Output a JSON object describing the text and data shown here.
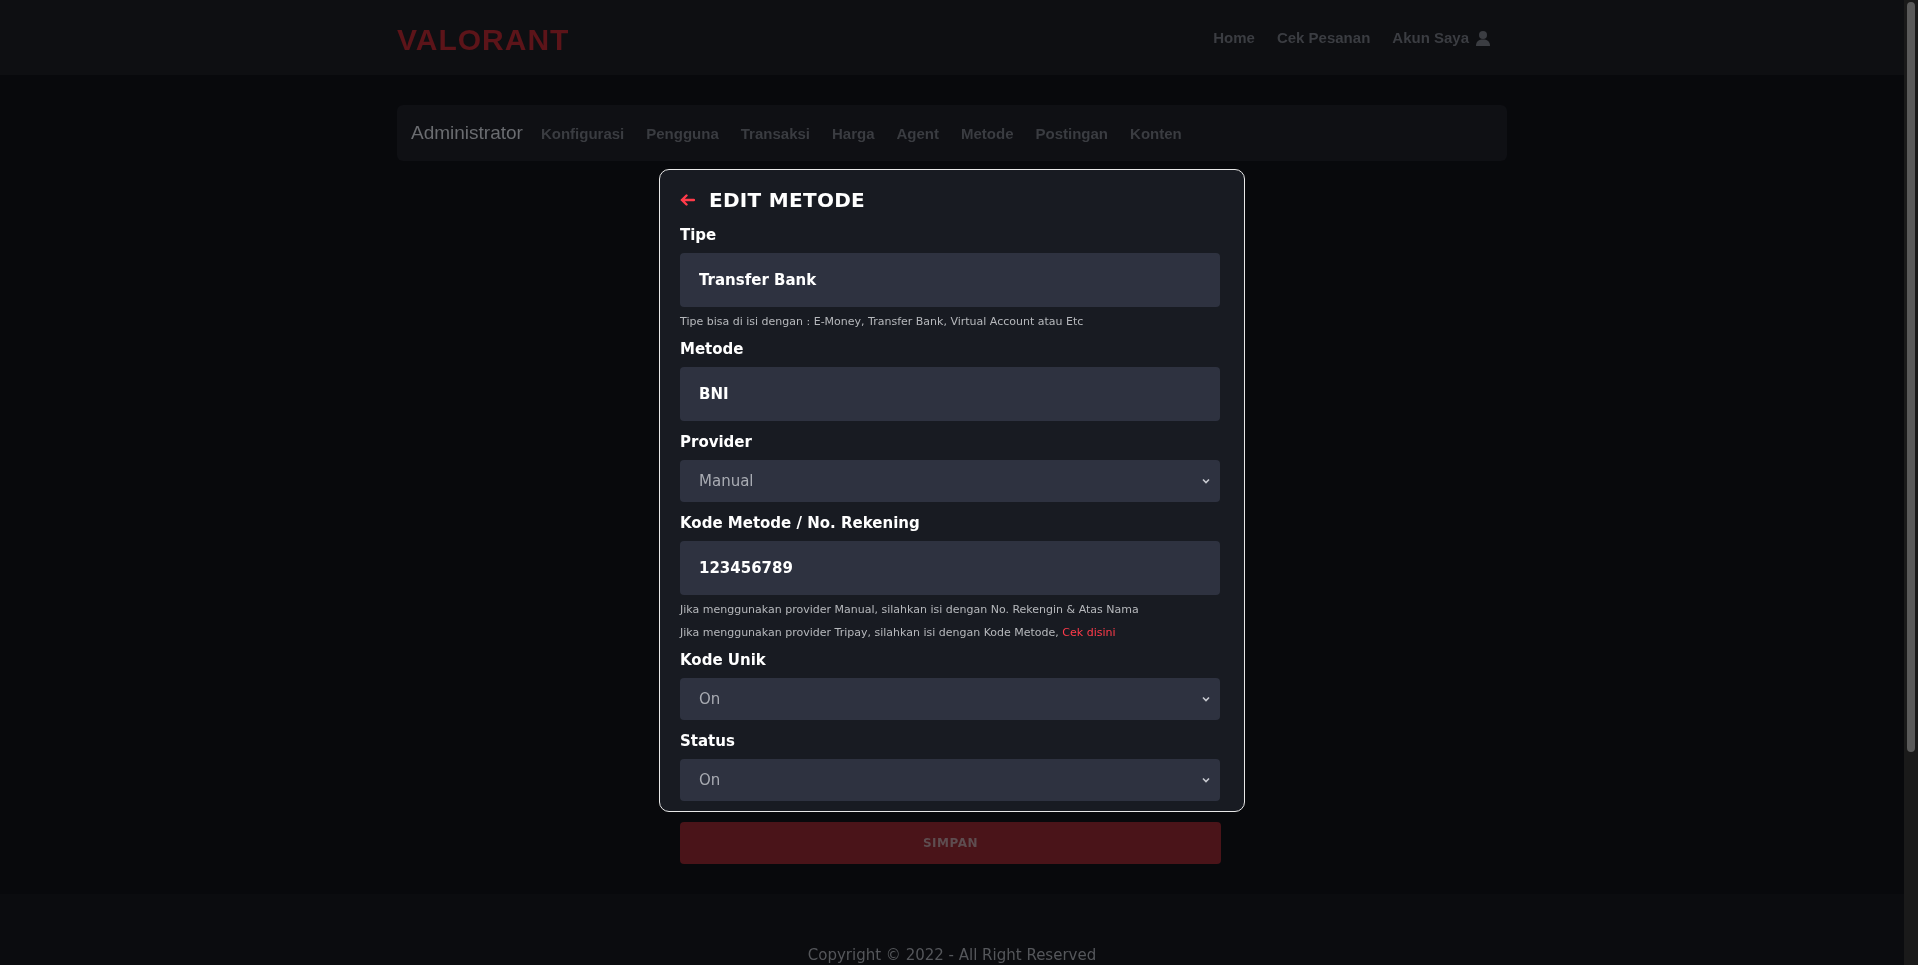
{
  "header": {
    "logo": "VALORANT",
    "nav": [
      {
        "label": "Home",
        "kind": "link"
      },
      {
        "label": "Cek Pesanan",
        "kind": "link"
      },
      {
        "label": "Akun Saya",
        "kind": "account"
      }
    ]
  },
  "admin_bar": {
    "title": "Administrator",
    "items": [
      "Konfigurasi",
      "Pengguna",
      "Transaksi",
      "Harga",
      "Agent",
      "Metode",
      "Postingan",
      "Konten"
    ]
  },
  "form": {
    "title": "EDIT METODE",
    "fields": [
      {
        "kind": "input",
        "label": "Tipe",
        "value": "Transfer Bank",
        "hints": [
          {
            "text": "Tipe bisa di isi dengan : E-Money, Transfer Bank, Virtual Account atau Etc"
          }
        ]
      },
      {
        "kind": "input",
        "label": "Metode",
        "value": "BNI"
      },
      {
        "kind": "select",
        "label": "Provider",
        "value": "Manual"
      },
      {
        "kind": "input",
        "label": "Kode Metode / No. Rekening",
        "value": "123456789",
        "hints": [
          {
            "text": "Jika menggunakan provider Manual, silahkan isi dengan No. Rekengin & Atas Nama"
          },
          {
            "text": "Jika menggunakan provider Tripay, silahkan isi dengan Kode Metode, ",
            "link": "Cek disini"
          }
        ]
      },
      {
        "kind": "select",
        "label": "Kode Unik",
        "value": "On"
      },
      {
        "kind": "select",
        "label": "Status",
        "value": "On"
      }
    ],
    "submit": "SIMPAN"
  },
  "footer": {
    "copyright": "Copyright © 2022 - All Right Reserved"
  }
}
